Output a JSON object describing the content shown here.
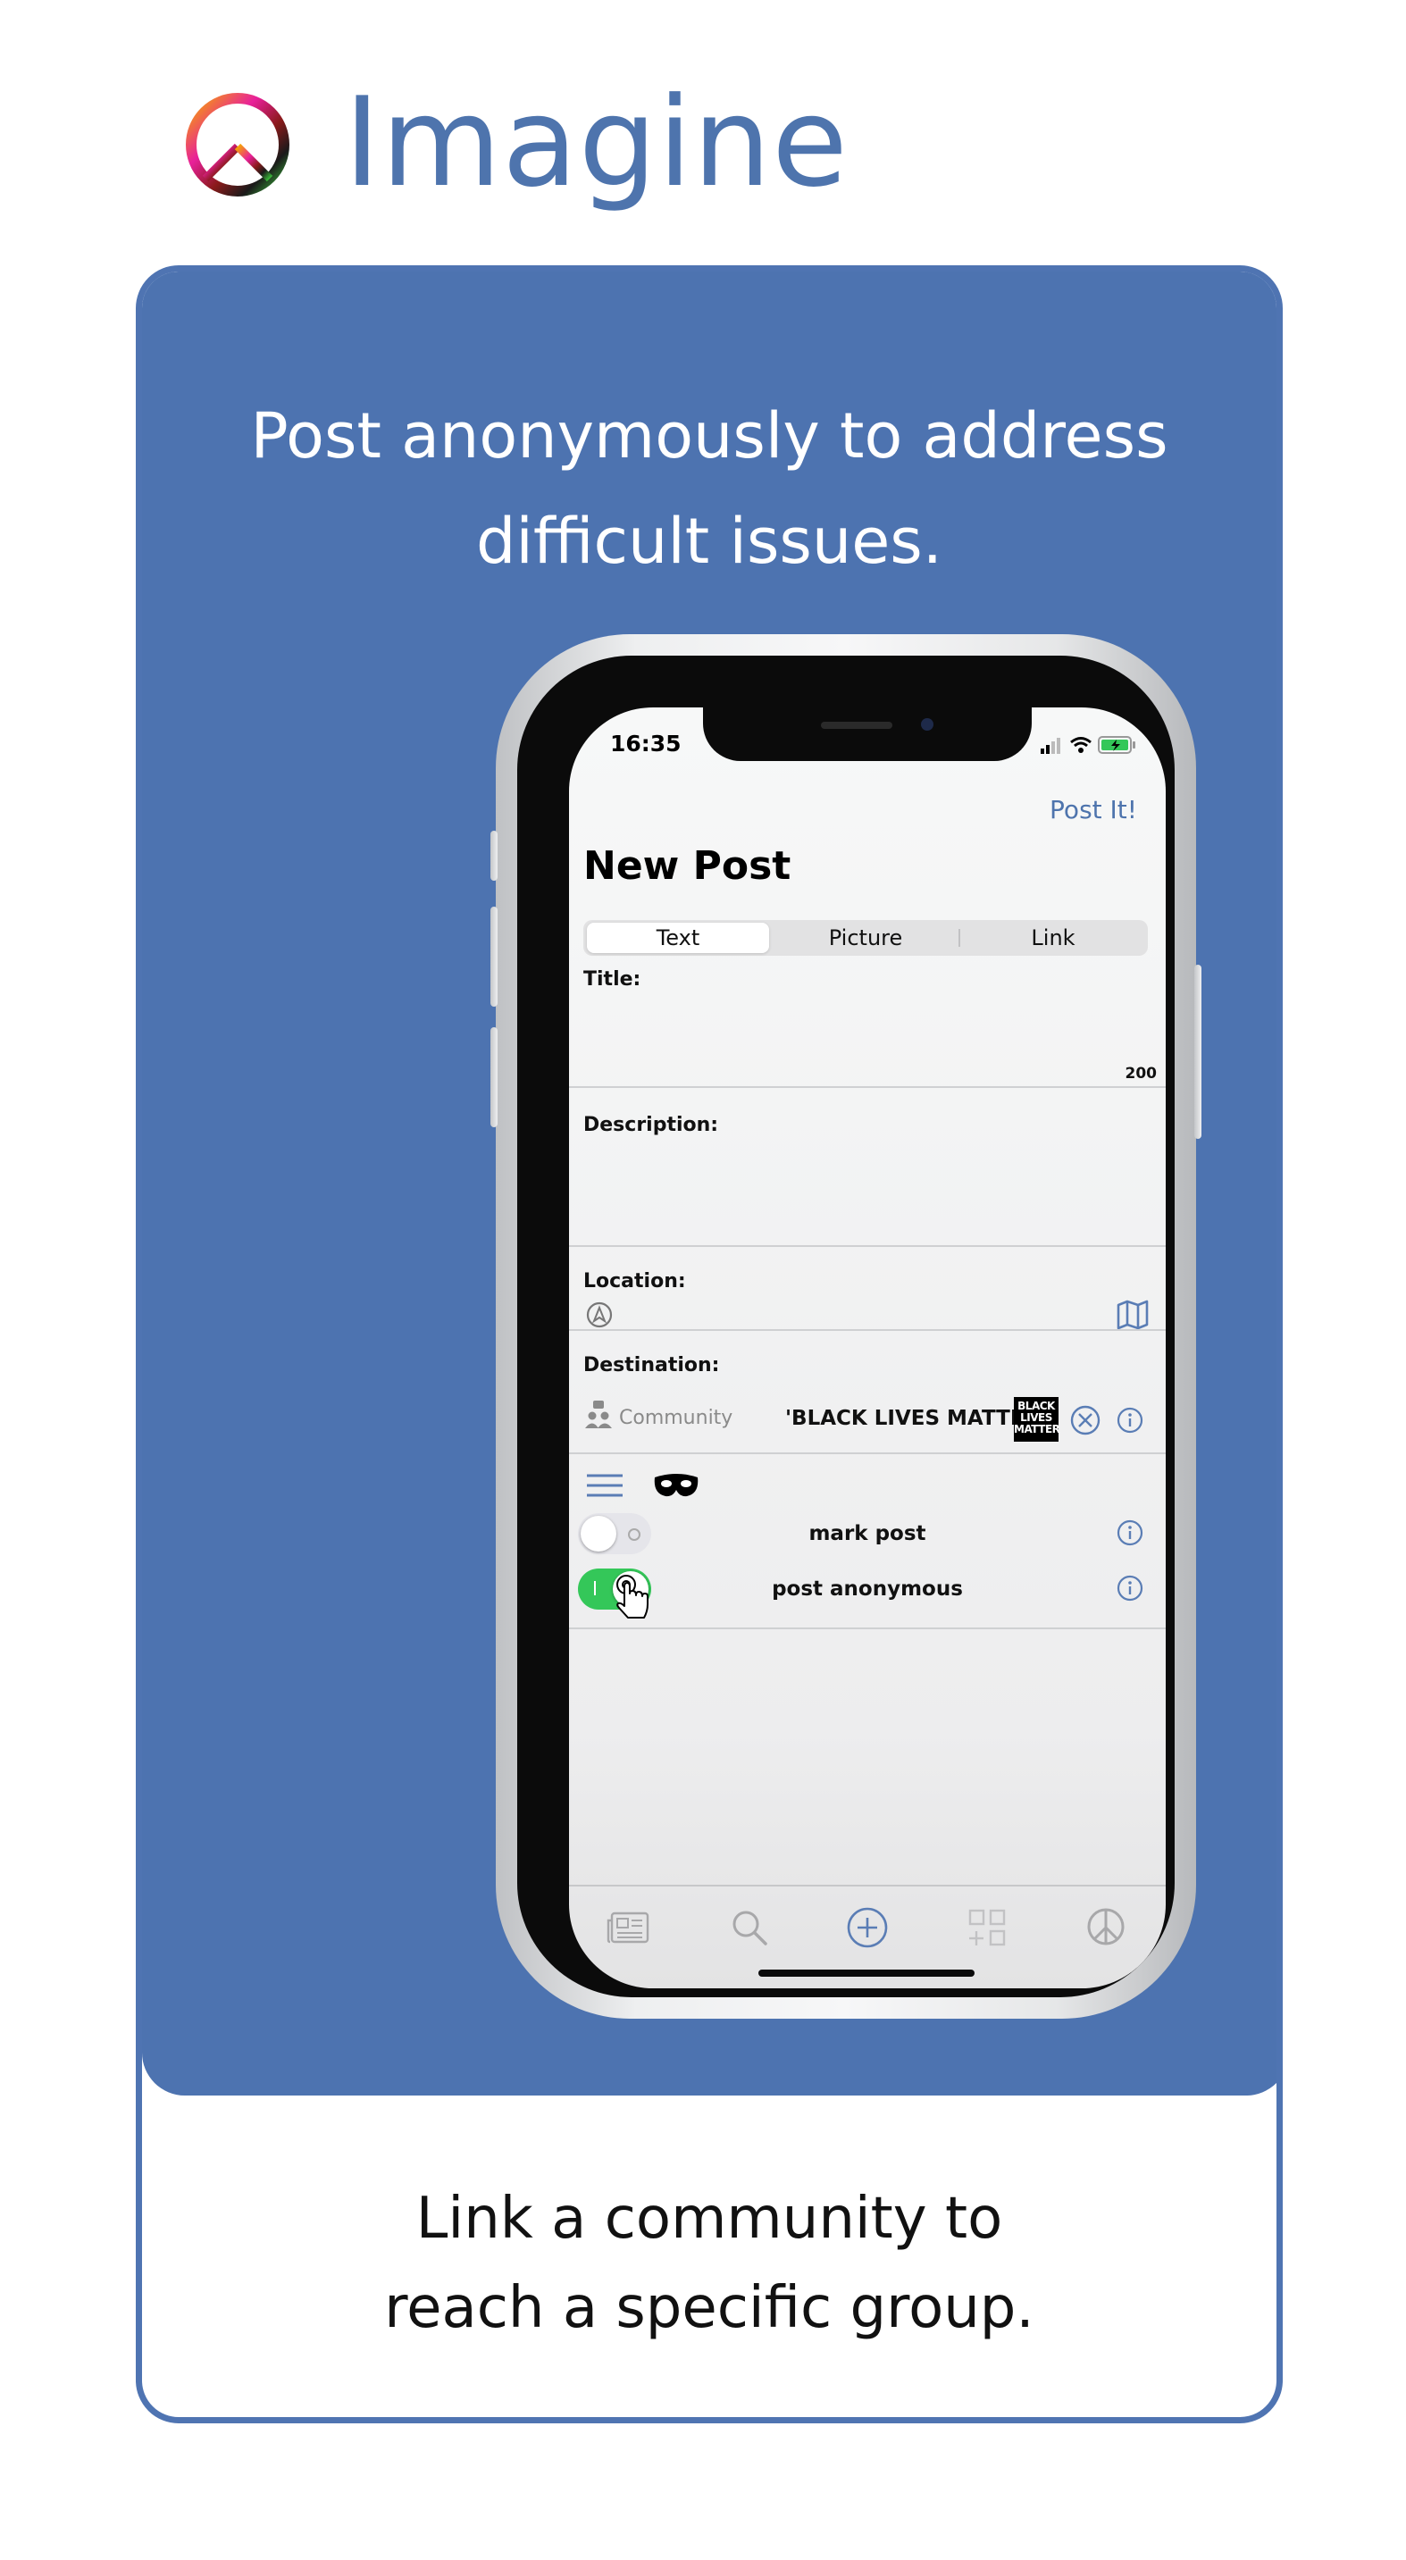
{
  "brand": {
    "app_name": "Imagine",
    "logo_icon": "peace-sign-icon"
  },
  "card": {
    "headline": "Post anonymously to address difficult issues.",
    "caption_line1": "Link a community to",
    "caption_line2": "reach a specific group.",
    "accent_color": "#4d73b0"
  },
  "phone": {
    "status_bar": {
      "time": "16:35"
    },
    "nav": {
      "action": "Post It!",
      "title": "New Post"
    },
    "segments": [
      "Text",
      "Picture",
      "Link"
    ],
    "selected_segment": "Text",
    "form": {
      "title_label": "Title:",
      "title_counter": "200",
      "description_label": "Description:",
      "location_label": "Location:",
      "destination_label": "Destination:",
      "destination_type": "Community",
      "destination_name": "'BLACK LIVES MATTER'",
      "destination_badge": "BLACK LIVES MATTER"
    },
    "toggles": [
      {
        "label": "mark post",
        "on": false
      },
      {
        "label": "post anonymous",
        "on": true
      }
    ],
    "toggle_on_color": "#34c759",
    "tab_bar": [
      "newspaper-icon",
      "search-icon",
      "add-icon",
      "grid-icon",
      "peace-icon"
    ]
  }
}
